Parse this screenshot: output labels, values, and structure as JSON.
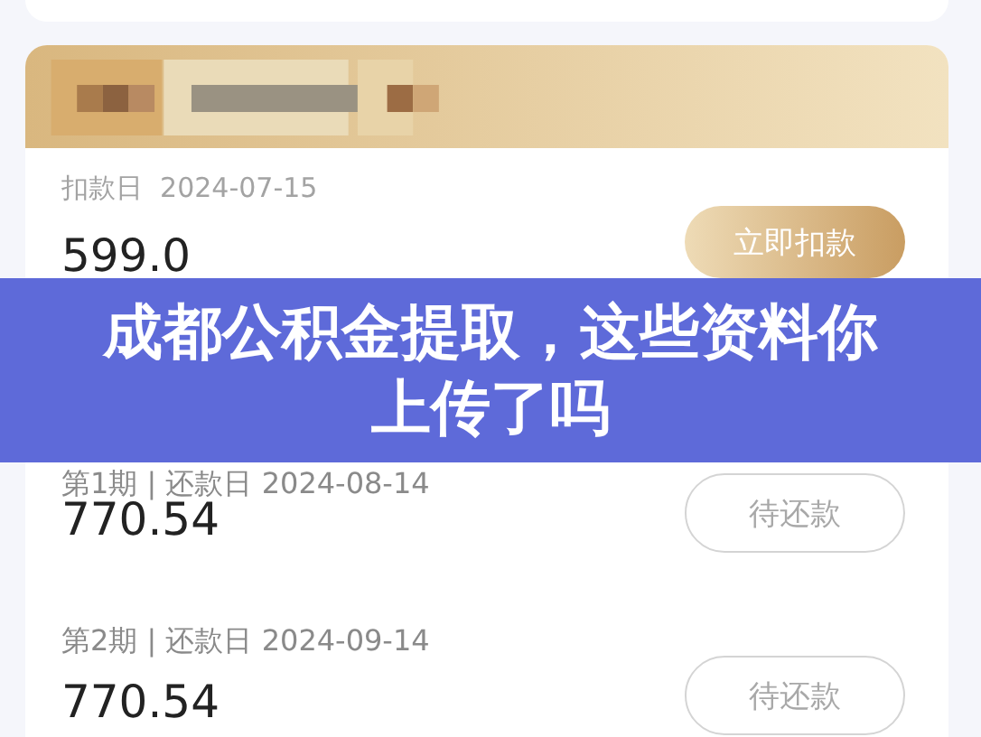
{
  "deduction": {
    "label": "扣款日",
    "date": "2024-07-15",
    "amount": "599.0",
    "button": {
      "kind": "primary",
      "label": "立即扣款"
    }
  },
  "installments": [
    {
      "label": "第1期 | 还款日 2024-08-14",
      "amount": "770.54",
      "button": {
        "kind": "outline",
        "label": "待还款"
      }
    },
    {
      "label": "第2期 | 还款日 2024-09-14",
      "amount": "770.54",
      "button": {
        "kind": "outline",
        "label": "待还款"
      }
    }
  ],
  "banner": {
    "title": "成都公积金提取，这些资料你上传了吗"
  }
}
